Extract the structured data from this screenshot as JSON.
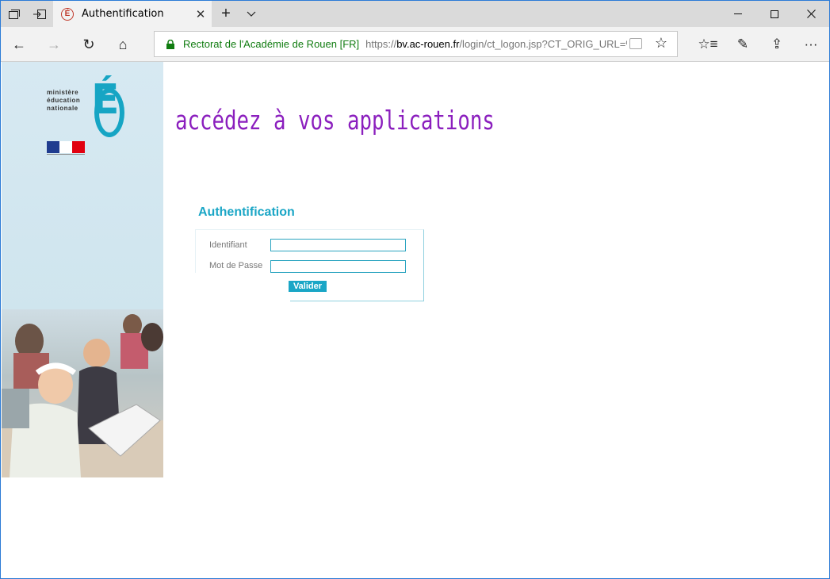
{
  "browser": {
    "tab_title": "Authentification",
    "tab_favicon_letter": "É",
    "site_identity": "Rectorat de l'Académie de Rouen [FR]",
    "url_scheme": "https://",
    "url_host": "bv.ac-rouen.fr",
    "url_path": "/login/ct_logon.jsp?CT_ORIG_URL=%",
    "icons": {
      "tab_preview": "tab-preview-icon",
      "set_aside": "set-aside-icon",
      "new_tab": "+",
      "tab_menu": "⌄",
      "minimize": "—",
      "maximize": "☐",
      "close": "✕",
      "back": "←",
      "forward": "→",
      "refresh": "↻",
      "home": "⌂",
      "favorite": "☆",
      "favorites_hub": "☆≡",
      "pen": "✎",
      "share": "⇪",
      "more": "···"
    }
  },
  "page": {
    "logo_lines": [
      "ministère",
      "éducation",
      "nationale"
    ],
    "logo_letter": "É",
    "heading": "accédez à vos applications",
    "auth_title": "Authentification",
    "fields": {
      "username_label": "Identifiant",
      "username_value": "",
      "password_label": "Mot de Passe",
      "password_value": ""
    },
    "submit_label": "Valider",
    "colors": {
      "heading": "#8b1fbe",
      "accent": "#1aa6c6",
      "flag_blue": "#1f3c8f",
      "flag_red": "#e1000f"
    }
  }
}
